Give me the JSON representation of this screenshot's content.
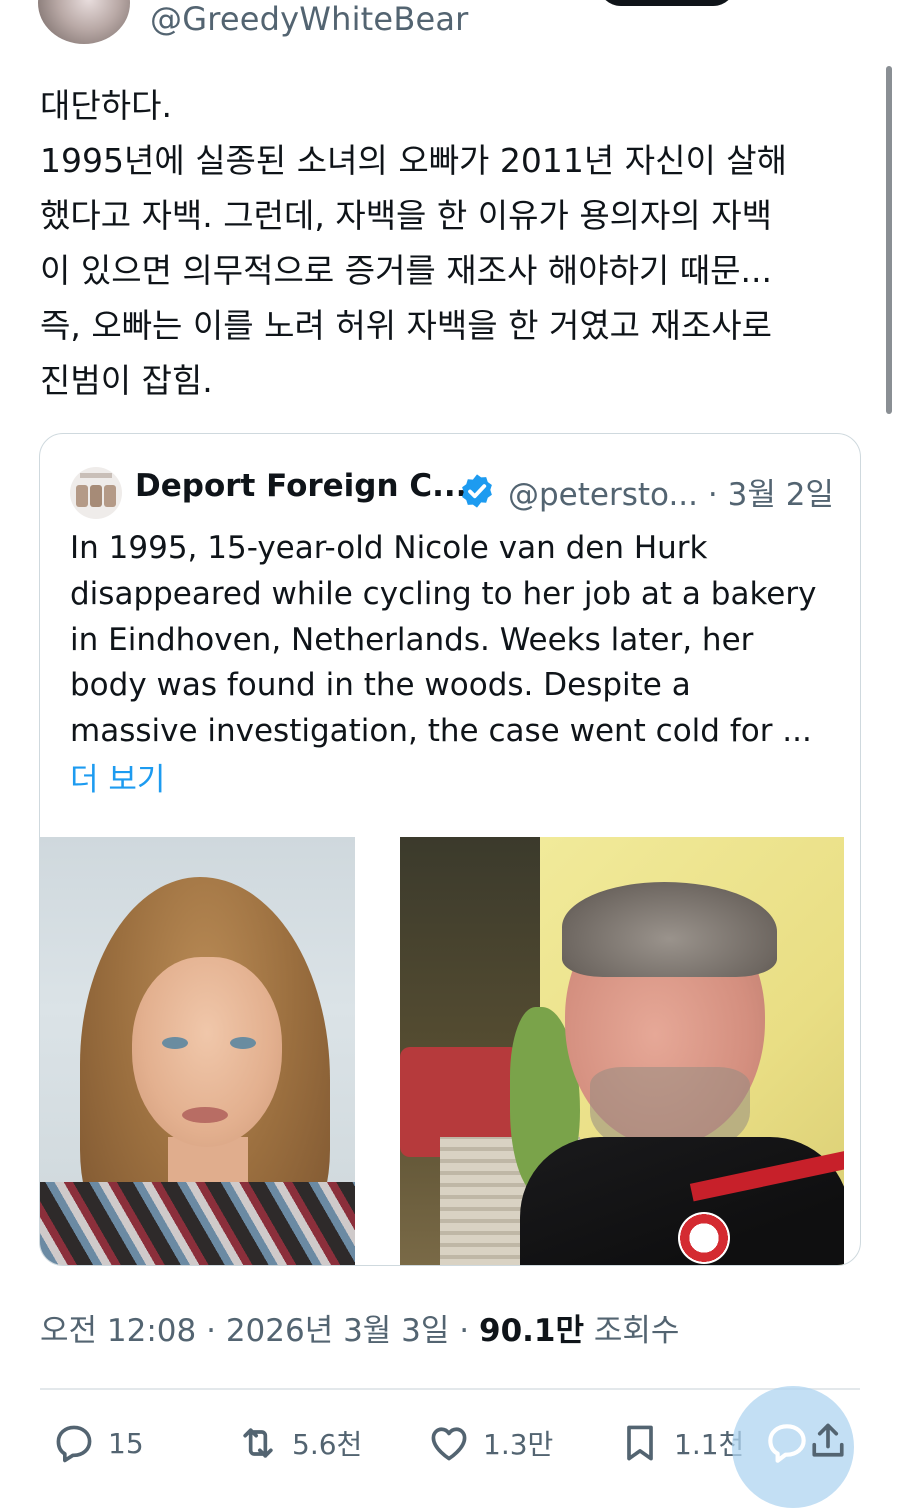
{
  "header": {
    "handle": "@GreedyWhiteBear"
  },
  "tweet": {
    "lines": [
      "대단하다.",
      "1995년에 실종된 소녀의 오빠가 2011년 자신이 살해",
      "했다고 자백. 그런데, 자백을 한 이유가 용의자의 자백",
      "이 있으면 의무적으로 증거를 재조사 해야하기 때문...",
      "즉, 오빠는 이를 노려 허위 자백을 한 거였고 재조사로",
      "진범이 잡힘."
    ]
  },
  "quote": {
    "name": "Deport Foreign C...",
    "handle": "@petersto...",
    "dot": "·",
    "date": "3월 2일",
    "body_lines": [
      "In 1995, 15-year-old Nicole van den Hurk",
      "disappeared while cycling to her job at a bakery",
      "in Eindhoven, Netherlands. Weeks later, her",
      "body was found in the woods. Despite a",
      "massive investigation, the case went cold for ..."
    ],
    "show_more": "더 보기",
    "verified_color": "#1d9bf0"
  },
  "meta": {
    "time": "오전 12:08",
    "date": "2026년 3월 3일",
    "views_count": "90.1만",
    "views_label": "조회수",
    "separator": "·"
  },
  "actions": {
    "replies": "15",
    "retweets": "5.6천",
    "likes": "1.3만",
    "bookmarks": "1.1천"
  },
  "colors": {
    "accent": "#1d9bf0",
    "text": "#0f1419",
    "muted": "#536471"
  }
}
